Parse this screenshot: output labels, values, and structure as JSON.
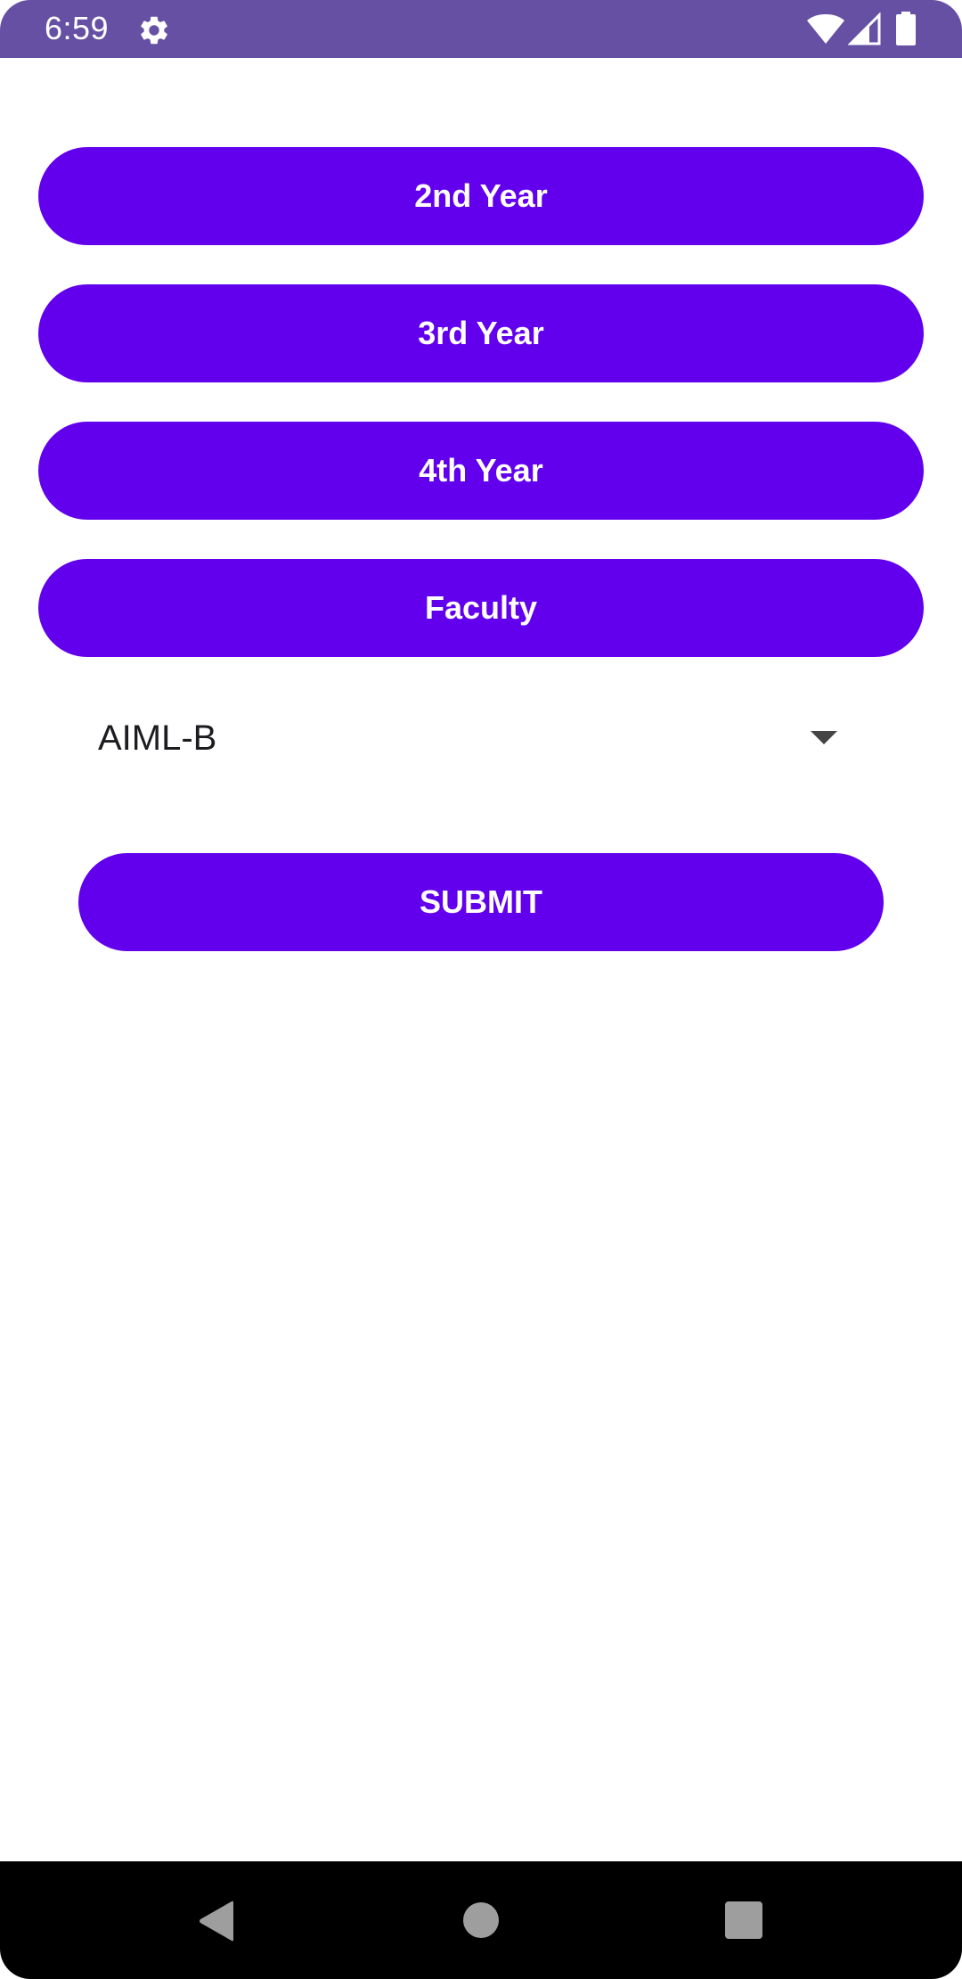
{
  "status_bar": {
    "time": "6:59",
    "icons": [
      "gear-icon",
      "wifi-icon",
      "signal-icon",
      "battery-icon"
    ]
  },
  "buttons": [
    {
      "label": "2nd Year"
    },
    {
      "label": "3rd Year"
    },
    {
      "label": "4th Year"
    },
    {
      "label": "Faculty"
    }
  ],
  "spinner": {
    "selected": "AIML-B",
    "icon": "dropdown-arrow-icon"
  },
  "submit": {
    "label": "SUBMIT"
  },
  "nav_bar": {
    "icons": [
      "back-icon",
      "home-icon",
      "recents-icon"
    ]
  },
  "colors": {
    "status_bar": "#6650a4",
    "button": "#6200ee",
    "button_text": "#ffffff",
    "nav_bar": "#000000"
  }
}
